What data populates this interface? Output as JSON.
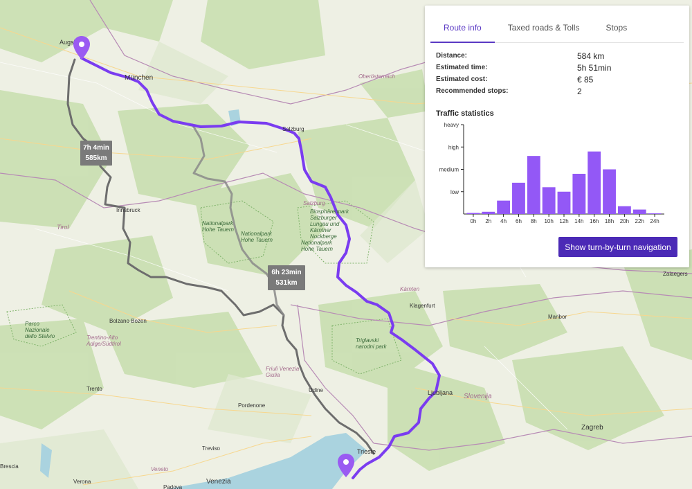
{
  "panel": {
    "tabs": [
      {
        "label": "Route info",
        "active": true
      },
      {
        "label": "Taxed roads & Tolls",
        "active": false
      },
      {
        "label": "Stops",
        "active": false
      }
    ],
    "route_info": [
      {
        "label": "Distance:",
        "value": "584 km"
      },
      {
        "label": "Estimated time:",
        "value": "5h 51min"
      },
      {
        "label": "Estimated cost:",
        "value": "€ 85"
      },
      {
        "label": "Recommended stops:",
        "value": "2"
      }
    ],
    "traffic_title": "Traffic statistics",
    "nav_button_label": "Show turn-by-turn navigation"
  },
  "chart_data": {
    "type": "bar",
    "title": "",
    "xlabel": "",
    "ylabel": "",
    "categories": [
      "0h",
      "2h",
      "4h",
      "6h",
      "8h",
      "10h",
      "12h",
      "14h",
      "16h",
      "18h",
      "20h",
      "22h",
      "24h"
    ],
    "values": [
      0.05,
      0.1,
      0.6,
      1.4,
      2.6,
      1.2,
      1.0,
      1.8,
      2.8,
      2.0,
      0.35,
      0.2,
      0.03
    ],
    "y_ticks": [
      {
        "label": "low",
        "value": 1
      },
      {
        "label": "medium",
        "value": 2
      },
      {
        "label": "high",
        "value": 3
      },
      {
        "label": "heavy",
        "value": 4
      }
    ],
    "ylim": [
      0,
      4
    ],
    "color": "#9358f6"
  },
  "map": {
    "route_alternatives": [
      {
        "time": "7h 4min",
        "distance": "585km"
      },
      {
        "time": "6h 23min",
        "distance": "531km"
      }
    ],
    "labels": [
      {
        "text": "Augsburg",
        "style": "city"
      },
      {
        "text": "München",
        "style": "city"
      },
      {
        "text": "Oberösterreich",
        "style": "region"
      },
      {
        "text": "Salzburg",
        "style": "city"
      },
      {
        "text": "Salzburg",
        "style": "region"
      },
      {
        "text": "Innsbruck",
        "style": "city"
      },
      {
        "text": "Tirol",
        "style": "region"
      },
      {
        "text": "Nationalpark Hohe Tauern",
        "style": "park"
      },
      {
        "text": "Nationalpark Hohe Tauern",
        "style": "park"
      },
      {
        "text": "Biosphärenpark Salzburger Lungau und Kärntner Nockberge",
        "style": "park"
      },
      {
        "text": "Nationalpark Hohe Tauern",
        "style": "park"
      },
      {
        "text": "Kärnten",
        "style": "region"
      },
      {
        "text": "Klagenfurt",
        "style": "city"
      },
      {
        "text": "Maribor",
        "style": "city"
      },
      {
        "text": "Zalaegers",
        "style": "city"
      },
      {
        "text": "Bolzano Bozen",
        "style": "city"
      },
      {
        "text": "Parco Nazionale dello Stelvio",
        "style": "park"
      },
      {
        "text": "Trentino-Alto Adige/Südtirol",
        "style": "region"
      },
      {
        "text": "Triglavski narodni park",
        "style": "park"
      },
      {
        "text": "Friuli Venezia Giulia",
        "style": "region"
      },
      {
        "text": "Udine",
        "style": "city"
      },
      {
        "text": "Ljubljana",
        "style": "city"
      },
      {
        "text": "Slovenija",
        "style": "region"
      },
      {
        "text": "Trento",
        "style": "city"
      },
      {
        "text": "Pordenone",
        "style": "city"
      },
      {
        "text": "Treviso",
        "style": "city"
      },
      {
        "text": "Trieste",
        "style": "city"
      },
      {
        "text": "Zagreb",
        "style": "city"
      },
      {
        "text": "Veneto",
        "style": "region"
      },
      {
        "text": "Venezia",
        "style": "city"
      },
      {
        "text": "Verona",
        "style": "city"
      },
      {
        "text": "Padova",
        "style": "city"
      },
      {
        "text": "Brescia",
        "style": "city"
      }
    ]
  }
}
